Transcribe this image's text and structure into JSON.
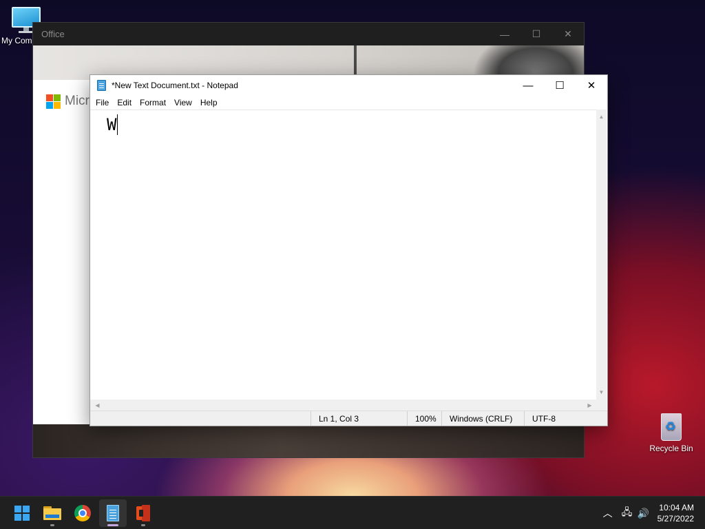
{
  "desktop": {
    "icons": [
      {
        "label": "My Com"
      },
      {
        "label": "Recycle Bin"
      }
    ]
  },
  "office_window": {
    "title": "Office",
    "controls": {
      "minimize": "—",
      "maximize": "☐",
      "close": "✕"
    },
    "brand_text": "Micro",
    "logo_colors": [
      "#f25022",
      "#7fba00",
      "#00a4ef",
      "#ffb900"
    ]
  },
  "notepad": {
    "title": "*New Text Document.txt - Notepad",
    "controls": {
      "minimize": "—",
      "maximize": "☐",
      "close": "✕"
    },
    "menu": [
      "File",
      "Edit",
      "Format",
      "View",
      "Help"
    ],
    "content": "W",
    "status": {
      "position": "Ln 1, Col 3",
      "zoom": "100%",
      "line_ending": "Windows (CRLF)",
      "encoding": "UTF-8"
    }
  },
  "taskbar": {
    "apps": [
      {
        "name": "start",
        "icon": "windows-logo-icon"
      },
      {
        "name": "file-explorer",
        "icon": "folder-icon"
      },
      {
        "name": "chrome",
        "icon": "chrome-icon"
      },
      {
        "name": "notepad",
        "icon": "notepad-icon",
        "active": true
      },
      {
        "name": "office",
        "icon": "office-icon"
      }
    ],
    "tray": {
      "chevron": "︿",
      "network": "🖧",
      "volume": "🔊",
      "time": "10:04 AM",
      "date": "5/27/2022"
    },
    "accent": "#3ba7f2"
  }
}
